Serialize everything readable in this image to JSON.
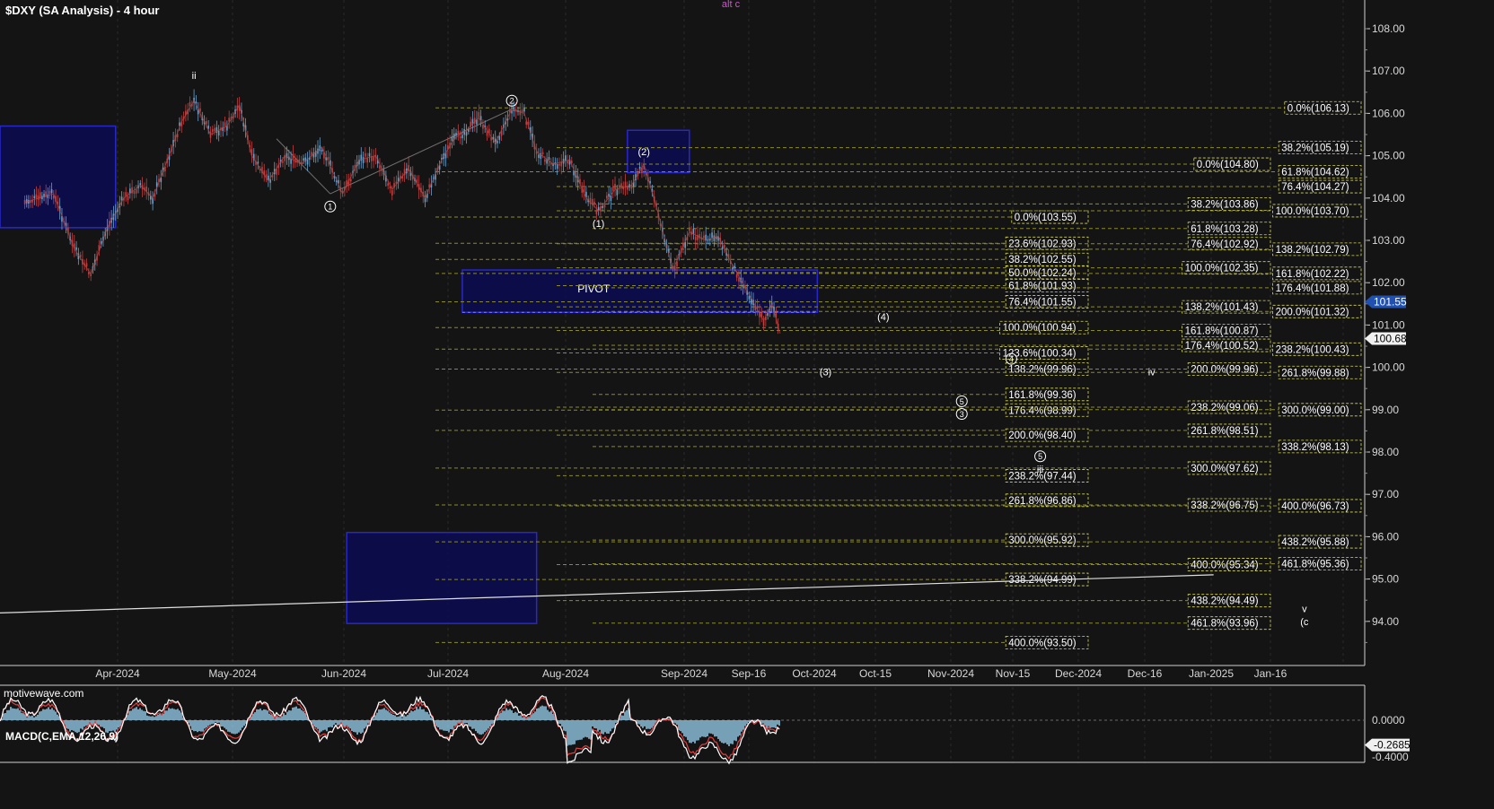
{
  "title": "$DXY (SA Analysis) - 4 hour",
  "watermark": "motivewave.com",
  "top_label": "alt c",
  "macd": {
    "title": "MACD(C,EMA,12,26,9)",
    "ticks": [
      {
        "v": 0,
        "label": "0.0000"
      },
      {
        "v": -0.4,
        "label": "-0.4000"
      }
    ],
    "current": "-0.2685"
  },
  "colors": {
    "background": "#141414",
    "grid": "#2a2a2a",
    "candle_up": "#6aa0c8",
    "candle_down": "#c04040",
    "fib_line": "#8a8a2a",
    "fib_box": "#d8d85a",
    "zone_fill": "#0a0a5a",
    "zone_stroke": "#2828c8",
    "macd_line": "#ffffff",
    "macd_signal": "#e04040",
    "macd_hist": "#8fc3e0"
  },
  "chart_data": {
    "type": "line",
    "x_axis_labels": [
      "Apr-2024",
      "May-2024",
      "Jun-2024",
      "Jul-2024",
      "Aug-2024",
      "Sep-2024",
      "Sep-16",
      "Oct-2024",
      "Oct-15",
      "Nov-2024",
      "Nov-15",
      "Dec-2024",
      "Dec-16",
      "Jan-2025",
      "Jan-16"
    ],
    "y_ticks": [
      94,
      95,
      96,
      97,
      98,
      99,
      100,
      101,
      102,
      103,
      104,
      105,
      106,
      107,
      108
    ],
    "ylim": [
      93.2,
      108.6
    ],
    "price_tags": [
      {
        "label": "101.55",
        "value": 101.55,
        "style": "blue"
      },
      {
        "label": "100.68",
        "value": 100.68,
        "style": "white"
      }
    ],
    "price_path": [
      {
        "t": "2024-03-18",
        "v": 103.9
      },
      {
        "t": "2024-03-25",
        "v": 104.1
      },
      {
        "t": "2024-03-30",
        "v": 102.8
      },
      {
        "t": "2024-04-03",
        "v": 102.2
      },
      {
        "t": "2024-04-07",
        "v": 103.3
      },
      {
        "t": "2024-04-11",
        "v": 104.0
      },
      {
        "t": "2024-04-15",
        "v": 104.3
      },
      {
        "t": "2024-04-18",
        "v": 104.0
      },
      {
        "t": "2024-04-20",
        "v": 104.5
      },
      {
        "t": "2024-04-25",
        "v": 105.8
      },
      {
        "t": "2024-04-28",
        "v": 106.3
      },
      {
        "t": "2024-05-02",
        "v": 105.5
      },
      {
        "t": "2024-05-06",
        "v": 105.7
      },
      {
        "t": "2024-05-09",
        "v": 106.2
      },
      {
        "t": "2024-05-12",
        "v": 105.0
      },
      {
        "t": "2024-05-16",
        "v": 104.4
      },
      {
        "t": "2024-05-20",
        "v": 105.0
      },
      {
        "t": "2024-05-24",
        "v": 104.8
      },
      {
        "t": "2024-05-29",
        "v": 105.2
      },
      {
        "t": "2024-06-03",
        "v": 104.1
      },
      {
        "t": "2024-06-07",
        "v": 104.9
      },
      {
        "t": "2024-06-11",
        "v": 105.0
      },
      {
        "t": "2024-06-15",
        "v": 104.2
      },
      {
        "t": "2024-06-19",
        "v": 104.7
      },
      {
        "t": "2024-06-23",
        "v": 104.0
      },
      {
        "t": "2024-06-27",
        "v": 104.9
      },
      {
        "t": "2024-06-30",
        "v": 105.4
      },
      {
        "t": "2024-07-03",
        "v": 105.6
      },
      {
        "t": "2024-07-06",
        "v": 105.9
      },
      {
        "t": "2024-07-10",
        "v": 105.3
      },
      {
        "t": "2024-07-14",
        "v": 106.1
      },
      {
        "t": "2024-07-17",
        "v": 106.0
      },
      {
        "t": "2024-07-20",
        "v": 105.1
      },
      {
        "t": "2024-07-24",
        "v": 104.8
      },
      {
        "t": "2024-07-28",
        "v": 104.9
      },
      {
        "t": "2024-08-01",
        "v": 104.0
      },
      {
        "t": "2024-08-04",
        "v": 103.7
      },
      {
        "t": "2024-08-08",
        "v": 104.2
      },
      {
        "t": "2024-08-12",
        "v": 104.3
      },
      {
        "t": "2024-08-15",
        "v": 104.8
      },
      {
        "t": "2024-08-18",
        "v": 103.8
      },
      {
        "t": "2024-08-22",
        "v": 102.3
      },
      {
        "t": "2024-08-26",
        "v": 103.2
      },
      {
        "t": "2024-08-30",
        "v": 103.0
      },
      {
        "t": "2024-09-02",
        "v": 103.1
      },
      {
        "t": "2024-09-05",
        "v": 102.5
      },
      {
        "t": "2024-09-09",
        "v": 101.8
      },
      {
        "t": "2024-09-13",
        "v": 101.1
      },
      {
        "t": "2024-09-15",
        "v": 101.5
      },
      {
        "t": "2024-09-17",
        "v": 100.8
      }
    ],
    "trendlines": [
      {
        "from": {
          "t": "2024-03-12",
          "v": 94.2
        },
        "to": {
          "t": "2024-12-31",
          "v": 95.1
        }
      },
      {
        "from": {
          "t": "2024-05-18",
          "v": 105.4
        },
        "to": {
          "t": "2024-05-31",
          "v": 104.1
        }
      },
      {
        "from": {
          "t": "2024-05-31",
          "v": 104.1
        },
        "to": {
          "t": "2024-07-14",
          "v": 106.1
        }
      }
    ],
    "zones": [
      {
        "from": "2024-03-12",
        "to": "2024-04-09",
        "top": 105.7,
        "bottom": 103.3
      },
      {
        "from": "2024-08-11",
        "to": "2024-08-26",
        "top": 105.6,
        "bottom": 104.6
      },
      {
        "from": "2024-07-02",
        "to": "2024-09-26",
        "top": 102.3,
        "bottom": 101.3,
        "label": "PIVOT"
      },
      {
        "from": "2024-06-04",
        "to": "2024-07-20",
        "top": 96.1,
        "bottom": 93.95
      }
    ],
    "fib_levels": [
      {
        "from": "2024-06-30",
        "to": "2024-11-10",
        "label": "0.0%(106.13)",
        "v": 106.13
      },
      {
        "from": "2024-06-30",
        "to": "2024-11-10",
        "label": "38.2%(105.19)",
        "v": 105.19
      },
      {
        "from": "2024-06-30",
        "to": "2024-11-10",
        "label": "0.0%(104.80)",
        "v": 104.8
      },
      {
        "from": "2024-06-30",
        "to": "2024-11-10",
        "label": "61.8%(104.62)",
        "v": 104.62
      },
      {
        "from": "2024-06-30",
        "to": "2024-11-10",
        "label": "76.4%(104.27)",
        "v": 104.27
      },
      {
        "from": "2024-06-30",
        "to": "2024-11-10",
        "label": "38.2%(103.86)",
        "v": 103.86
      },
      {
        "from": "2024-06-30",
        "to": "2024-11-10",
        "label": "0.0%(103.55)",
        "v": 103.55
      },
      {
        "from": "2024-06-30",
        "to": "2024-11-10",
        "label": "100.0%(103.70)",
        "v": 103.7
      },
      {
        "from": "2024-06-30",
        "to": "2024-11-10",
        "label": "61.8%(103.28)",
        "v": 103.28
      },
      {
        "from": "2024-06-30",
        "to": "2024-11-10",
        "label": "23.6%(102.93)",
        "v": 102.93
      },
      {
        "from": "2024-06-30",
        "to": "2024-11-10",
        "label": "76.4%(102.92)",
        "v": 102.92
      },
      {
        "from": "2024-06-30",
        "to": "2024-11-10",
        "label": "138.2%(102.79)",
        "v": 102.79
      },
      {
        "from": "2024-06-30",
        "to": "2024-11-10",
        "label": "38.2%(102.55)",
        "v": 102.55
      },
      {
        "from": "2024-06-30",
        "to": "2024-11-10",
        "label": "100.0%(102.35)",
        "v": 102.35
      },
      {
        "from": "2024-06-30",
        "to": "2024-11-10",
        "label": "50.0%(102.24)",
        "v": 102.24
      },
      {
        "from": "2024-06-30",
        "to": "2024-11-10",
        "label": "161.8%(102.22)",
        "v": 102.22
      },
      {
        "from": "2024-06-30",
        "to": "2024-11-10",
        "label": "61.8%(101.93)",
        "v": 101.93
      },
      {
        "from": "2024-06-30",
        "to": "2024-11-10",
        "label": "176.4%(101.88)",
        "v": 101.88
      },
      {
        "from": "2024-06-30",
        "to": "2024-11-10",
        "label": "76.4%(101.55)",
        "v": 101.55
      },
      {
        "from": "2024-06-30",
        "to": "2024-11-10",
        "label": "138.2%(101.43)",
        "v": 101.43
      },
      {
        "from": "2024-06-30",
        "to": "2024-11-10",
        "label": "200.0%(101.32)",
        "v": 101.32
      },
      {
        "from": "2024-06-30",
        "to": "2024-11-10",
        "label": "100.0%(100.94)",
        "v": 100.94
      },
      {
        "from": "2024-06-30",
        "to": "2024-11-10",
        "label": "161.8%(100.87)",
        "v": 100.87
      },
      {
        "from": "2024-06-30",
        "to": "2024-11-10",
        "label": "176.4%(100.52)",
        "v": 100.52
      },
      {
        "from": "2024-06-30",
        "to": "2024-11-10",
        "label": "238.2%(100.43)",
        "v": 100.43
      },
      {
        "from": "2024-06-30",
        "to": "2024-11-10",
        "label": "123.6%(100.34)",
        "v": 100.34
      },
      {
        "from": "2024-06-30",
        "to": "2024-11-10",
        "label": "138.2%(99.96)",
        "v": 99.96
      },
      {
        "from": "2024-06-30",
        "to": "2024-11-10",
        "label": "200.0%(99.96)",
        "v": 99.96
      },
      {
        "from": "2024-06-30",
        "to": "2024-11-10",
        "label": "261.8%(99.88)",
        "v": 99.88
      },
      {
        "from": "2024-06-30",
        "to": "2024-11-10",
        "label": "161.8%(99.36)",
        "v": 99.36
      },
      {
        "from": "2024-06-30",
        "to": "2024-11-10",
        "label": "176.4%(98.99)",
        "v": 98.99
      },
      {
        "from": "2024-06-30",
        "to": "2024-11-10",
        "label": "238.2%(99.06)",
        "v": 99.06
      },
      {
        "from": "2024-06-30",
        "to": "2024-11-10",
        "label": "300.0%(99.00)",
        "v": 99.0
      },
      {
        "from": "2024-06-30",
        "to": "2024-11-10",
        "label": "261.8%(98.51)",
        "v": 98.51
      },
      {
        "from": "2024-06-30",
        "to": "2024-11-10",
        "label": "200.0%(98.40)",
        "v": 98.4
      },
      {
        "from": "2024-06-30",
        "to": "2024-11-10",
        "label": "338.2%(98.13)",
        "v": 98.13
      },
      {
        "from": "2024-06-30",
        "to": "2024-11-10",
        "label": "300.0%(97.62)",
        "v": 97.62
      },
      {
        "from": "2024-06-30",
        "to": "2024-11-10",
        "label": "238.2%(97.44)",
        "v": 97.44
      },
      {
        "from": "2024-06-30",
        "to": "2024-11-10",
        "label": "261.8%(96.86)",
        "v": 96.86
      },
      {
        "from": "2024-06-30",
        "to": "2024-11-10",
        "label": "338.2%(96.75)",
        "v": 96.75
      },
      {
        "from": "2024-06-30",
        "to": "2024-11-10",
        "label": "400.0%(96.73)",
        "v": 96.73
      },
      {
        "from": "2024-06-30",
        "to": "2024-11-10",
        "label": "300.0%(95.92)",
        "v": 95.92
      },
      {
        "from": "2024-06-30",
        "to": "2024-11-10",
        "label": "438.2%(95.88)",
        "v": 95.88
      },
      {
        "from": "2024-06-30",
        "to": "2024-11-10",
        "label": "400.0%(95.34)",
        "v": 95.34
      },
      {
        "from": "2024-06-30",
        "to": "2024-11-10",
        "label": "461.8%(95.36)",
        "v": 95.36
      },
      {
        "from": "2024-06-30",
        "to": "2024-11-10",
        "label": "338.2%(94.99)",
        "v": 94.99
      },
      {
        "from": "2024-06-30",
        "to": "2024-11-10",
        "label": "438.2%(94.49)",
        "v": 94.49
      },
      {
        "from": "2024-06-30",
        "to": "2024-11-10",
        "label": "461.8%(93.96)",
        "v": 93.96
      },
      {
        "from": "2024-06-30",
        "to": "2024-11-10",
        "label": "400.0%(93.50)",
        "v": 93.5
      }
    ],
    "wave_labels": [
      {
        "label": "ii",
        "t": "2024-04-28",
        "v": 106.9,
        "circle": false
      },
      {
        "label": "1",
        "t": "2024-05-31",
        "v": 103.8,
        "circle": true
      },
      {
        "label": "2",
        "t": "2024-07-14",
        "v": 106.3,
        "circle": true
      },
      {
        "label": "(2)",
        "t": "2024-08-15",
        "v": 105.1,
        "circle": false
      },
      {
        "label": "(1)",
        "t": "2024-08-04",
        "v": 103.4,
        "circle": false
      },
      {
        "label": "(4)",
        "t": "2024-10-12",
        "v": 101.2,
        "circle": false
      },
      {
        "label": "(3)",
        "t": "2024-09-28",
        "v": 99.9,
        "circle": false
      },
      {
        "label": "4",
        "t": "2024-11-12",
        "v": 100.2,
        "circle": true
      },
      {
        "label": "iv",
        "t": "2024-12-16",
        "v": 99.9,
        "circle": false
      },
      {
        "label": "5",
        "t": "2024-10-31",
        "v": 99.2,
        "circle": true
      },
      {
        "label": "3",
        "t": "2024-10-31",
        "v": 98.9,
        "circle": true
      },
      {
        "label": "5",
        "t": "2024-11-19",
        "v": 97.9,
        "circle": true
      },
      {
        "label": "iii",
        "t": "2024-11-19",
        "v": 97.6,
        "circle": false
      },
      {
        "label": "v",
        "t": "2025-01-22",
        "v": 94.3,
        "circle": false
      },
      {
        "label": "(c",
        "t": "2025-01-22",
        "v": 94.0,
        "circle": false
      }
    ]
  }
}
